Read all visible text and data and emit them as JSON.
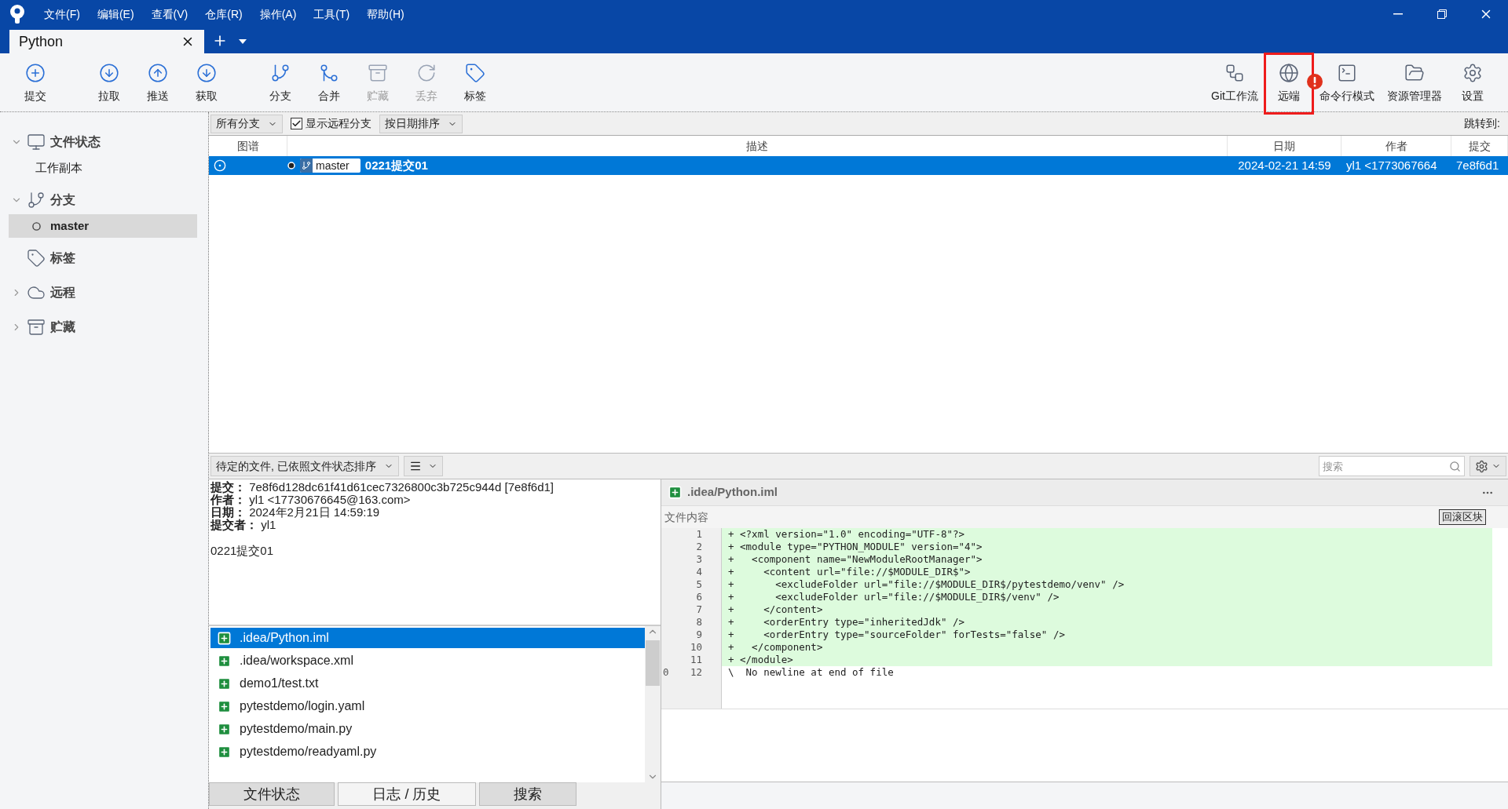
{
  "menu": [
    "文件(F)",
    "编辑(E)",
    "查看(V)",
    "仓库(R)",
    "操作(A)",
    "工具(T)",
    "帮助(H)"
  ],
  "tabs": [
    {
      "label": "Python",
      "selected": true
    }
  ],
  "toolbar_left": [
    {
      "label": "提交",
      "disabled": false
    },
    {
      "label": "拉取",
      "disabled": false
    },
    {
      "label": "推送",
      "disabled": false
    },
    {
      "label": "获取",
      "disabled": false
    },
    {
      "label": "分支",
      "disabled": false
    },
    {
      "label": "合并",
      "disabled": false
    },
    {
      "label": "贮藏",
      "disabled": true
    },
    {
      "label": "丢弃",
      "disabled": true
    },
    {
      "label": "标签",
      "disabled": false
    }
  ],
  "toolbar_right": [
    {
      "label": "Git工作流",
      "highlighted": false,
      "alert": false
    },
    {
      "label": "远端",
      "highlighted": true,
      "alert": true
    },
    {
      "label": "命令行模式",
      "highlighted": false,
      "alert": false
    },
    {
      "label": "资源管理器",
      "highlighted": false,
      "alert": false
    },
    {
      "label": "设置",
      "highlighted": false,
      "alert": false
    }
  ],
  "sidebar": [
    {
      "label": "文件状态",
      "expanded": true,
      "children": [
        {
          "label": "工作副本",
          "selected": false
        }
      ]
    },
    {
      "label": "分支",
      "expanded": true,
      "children": [
        {
          "label": "master",
          "selected": true
        }
      ]
    },
    {
      "label": "标签"
    },
    {
      "label": "远程",
      "expanded": false
    },
    {
      "label": "贮藏",
      "expanded": false
    }
  ],
  "filters": {
    "branches": "所有分支",
    "show_remote": {
      "label": "显示远程分支",
      "checked": true
    },
    "sort": "按日期排序",
    "jump_to": "跳转到:"
  },
  "commit_table": {
    "columns": [
      "图谱",
      "描述",
      "日期",
      "作者",
      "提交"
    ],
    "rows": [
      {
        "selected": true,
        "branch": "master",
        "message": "0221提交01",
        "date": "2024-02-21 14:59",
        "author": "yl1 <1773067664",
        "commit": "7e8f6d1"
      }
    ]
  },
  "files_toolbar": {
    "sort": "待定的文件, 已依照文件状态排序",
    "search": {
      "placeholder": "搜索"
    }
  },
  "commit_details": [
    {
      "label": "提交：",
      "value": "7e8f6d128dc61f41d61cec7326800c3b725c944d [7e8f6d1]"
    },
    {
      "label": "作者：",
      "value": "yl1 <17730676645@163.com>"
    },
    {
      "label": "日期：",
      "value": "2024年2月21日 14:59:19"
    },
    {
      "label": "提交者：",
      "value": "yl1"
    }
  ],
  "commit_message": "0221提交01",
  "files": [
    {
      "path": ".idea/Python.iml",
      "selected": true
    },
    {
      "path": ".idea/workspace.xml",
      "selected": false
    },
    {
      "path": "demo1/test.txt",
      "selected": false
    },
    {
      "path": "pytestdemo/login.yaml",
      "selected": false
    },
    {
      "path": "pytestdemo/main.py",
      "selected": false
    },
    {
      "path": "pytestdemo/readyaml.py",
      "selected": false
    }
  ],
  "bottom_tabs": [
    {
      "label": "文件状态",
      "selected": false
    },
    {
      "label": "日志 / 历史",
      "selected": true
    },
    {
      "label": "搜索",
      "selected": false
    }
  ],
  "diff": {
    "file": ".idea/Python.iml",
    "section": "文件内容",
    "revert_button": "回滚区块",
    "lines": [
      {
        "new": "1",
        "text": "+ <?xml version=\"1.0\" encoding=\"UTF-8\"?>",
        "kind": "added"
      },
      {
        "new": "2",
        "text": "+ <module type=\"PYTHON_MODULE\" version=\"4\">",
        "kind": "added"
      },
      {
        "new": "3",
        "text": "+   <component name=\"NewModuleRootManager\">",
        "kind": "added"
      },
      {
        "new": "4",
        "text": "+     <content url=\"file://$MODULE_DIR$\">",
        "kind": "added"
      },
      {
        "new": "5",
        "text": "+       <excludeFolder url=\"file://$MODULE_DIR$/pytestdemo/venv\" />",
        "kind": "added"
      },
      {
        "new": "6",
        "text": "+       <excludeFolder url=\"file://$MODULE_DIR$/venv\" />",
        "kind": "added"
      },
      {
        "new": "7",
        "text": "+     </content>",
        "kind": "added"
      },
      {
        "new": "8",
        "text": "+     <orderEntry type=\"inheritedJdk\" />",
        "kind": "added"
      },
      {
        "new": "9",
        "text": "+     <orderEntry type=\"sourceFolder\" forTests=\"false\" />",
        "kind": "added"
      },
      {
        "new": "10",
        "text": "+   </component>",
        "kind": "added"
      },
      {
        "new": "11",
        "text": "+ </module>",
        "kind": "added"
      },
      {
        "old": "0",
        "new": "12",
        "text": "\\  No newline at end of file",
        "kind": "context"
      }
    ]
  }
}
